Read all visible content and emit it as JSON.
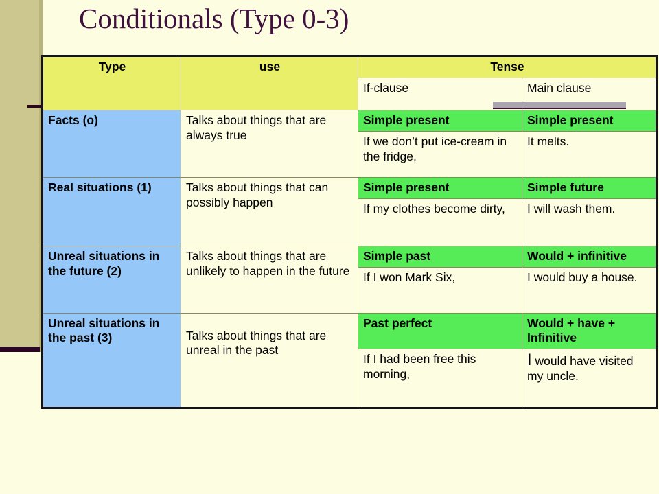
{
  "slide": {
    "title": "Conditionals (Type 0-3)",
    "background_color": "#fdfde1",
    "title_color": "#40103f",
    "accent_band_color": "#cbc78e",
    "accent_line_color": "#2b0426",
    "header_color": "#e9ef68",
    "type_cell_color": "#95c7f8",
    "tense_cell_color": "#56ec57",
    "overlay_bar_color": "#a8a5ae"
  },
  "table": {
    "headers": {
      "type": "Type",
      "use": "use",
      "tense": "Tense",
      "if_clause": "If-clause",
      "main_clause": "Main clause"
    },
    "rows": [
      {
        "type": "Facts (o)",
        "use": "Talks about things that are always true",
        "if_tense": "Simple present",
        "main_tense": "Simple present",
        "if_example": "If we don’t put ice-cream in the fridge,",
        "main_example": "It melts."
      },
      {
        "type": "Real situations (1)",
        "use": "Talks about things that can possibly happen",
        "if_tense": "Simple present",
        "main_tense": "Simple future",
        "if_example": "If my clothes become dirty,",
        "main_example": "I will wash them."
      },
      {
        "type": "Unreal situations in the future (2)",
        "use": "Talks about things that are unlikely to happen in the future",
        "if_tense": "Simple past",
        "main_tense": "Would + infinitive",
        "if_example": "If I won Mark Six,",
        "main_example": "I would buy a house."
      },
      {
        "type": "Unreal situations in the past (3)",
        "use": "Talks about things that are unreal in the past",
        "if_tense": "Past perfect",
        "main_tense": "Would + have + Infinitive",
        "if_example": "If I had been free this morning,",
        "main_example_lead": "I",
        "main_example_rest": " would have visited my uncle."
      }
    ]
  }
}
